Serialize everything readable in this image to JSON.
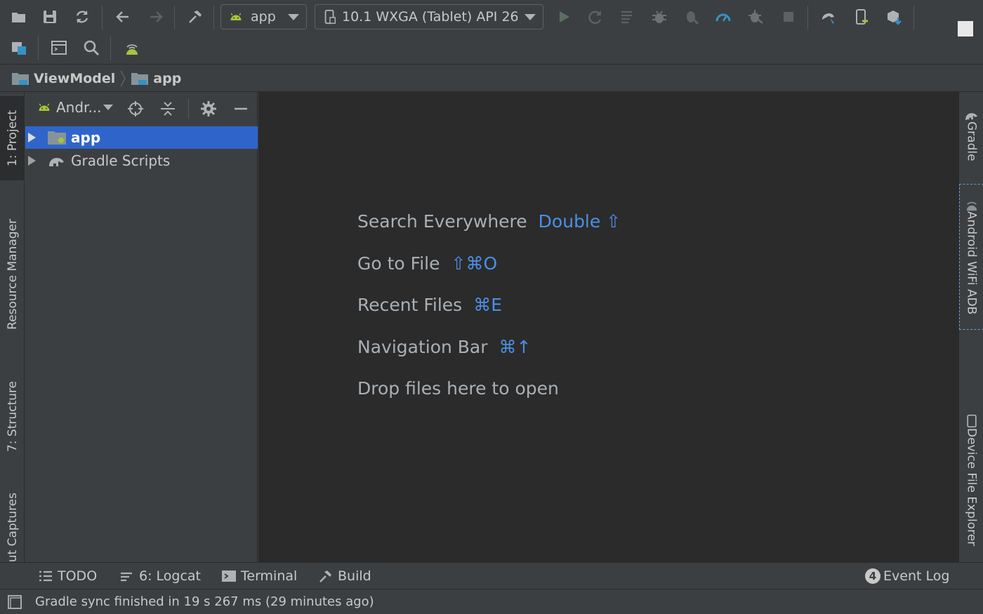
{
  "toolbar": {
    "run_config": "app",
    "device": "10.1  WXGA (Tablet) API 26",
    "buttons": [
      "open-icon",
      "save-icon",
      "sync-icon",
      "back-icon",
      "forward-icon",
      "build-hammer-icon",
      "run-icon",
      "apply-changes-icon",
      "apply-code-changes-icon",
      "debug-icon",
      "attach-debugger-icon",
      "profile-icon",
      "run-with-coverage-icon",
      "stop-icon",
      "sync-gradle-icon",
      "avd-manager-icon",
      "sdk-manager-icon",
      "project-structure-icon",
      "terminal-window-icon",
      "search-icon",
      "android-wifi-icon"
    ]
  },
  "breadcrumb": [
    "ViewModel",
    "app"
  ],
  "left_tabs": {
    "project": "1: Project",
    "resource_manager": "Resource Manager",
    "structure": "7: Structure",
    "captures": "ut Captures"
  },
  "right_tabs": {
    "gradle": "Gradle",
    "wifi_adb": "Android WiFi ADB",
    "device_explorer": "Device File Explorer"
  },
  "project_panel": {
    "view_selector": "Andr...",
    "tree": [
      {
        "label": "app",
        "selected": true
      },
      {
        "label": "Gradle Scripts",
        "selected": false
      }
    ]
  },
  "editor": {
    "hints": [
      {
        "label": "Search Everywhere",
        "shortcut": "Double ⇧"
      },
      {
        "label": "Go to File",
        "shortcut": "⇧⌘O"
      },
      {
        "label": "Recent Files",
        "shortcut": "⌘E"
      },
      {
        "label": "Navigation Bar",
        "shortcut": "⌘↑"
      },
      {
        "label": "Drop files here to open",
        "shortcut": ""
      }
    ]
  },
  "bottom_tools": {
    "todo": "TODO",
    "logcat": "6: Logcat",
    "terminal": "Terminal",
    "build": "Build",
    "event_log_count": "4",
    "event_log": "Event Log"
  },
  "status": "Gradle sync finished in 19 s 267 ms (29 minutes ago)",
  "colors": {
    "background": "#3c3f41",
    "editor": "#2b2b2b",
    "selection": "#2f65ca",
    "shortcut": "#4c8fe5",
    "android_green": "#a4c639"
  }
}
